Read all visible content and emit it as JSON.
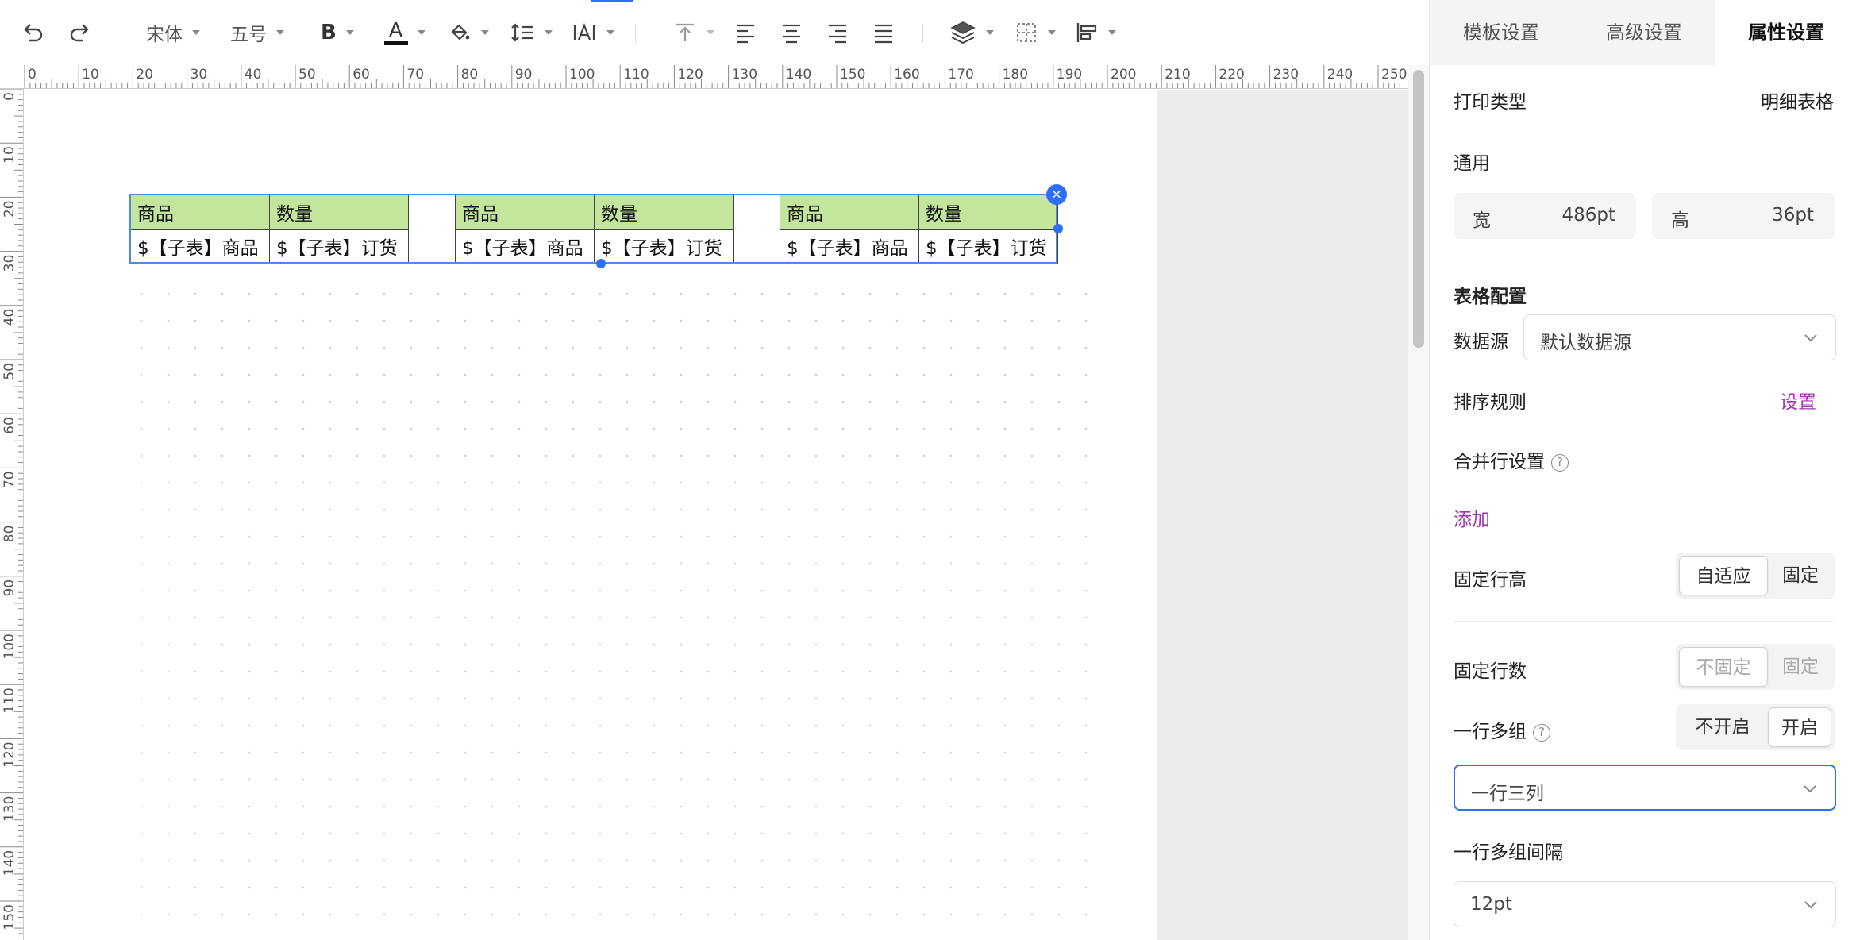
{
  "toolbar": {
    "font_family": "宋体",
    "font_size": "五号",
    "bold_label": "B",
    "font_color_label": "A",
    "font_color": "#111111"
  },
  "ruler": {
    "top_labels": [
      "0",
      "10",
      "20",
      "30",
      "40",
      "50",
      "60",
      "70",
      "80",
      "90",
      "100",
      "110",
      "120",
      "130",
      "140",
      "150",
      "160",
      "170",
      "180",
      "190",
      "200",
      "210",
      "220",
      "230",
      "240",
      "250"
    ],
    "left_labels": [
      "0",
      "10",
      "20",
      "30",
      "40",
      "50",
      "60",
      "70",
      "80",
      "90",
      "100",
      "110",
      "120",
      "130",
      "140",
      "150"
    ]
  },
  "canvas": {
    "tables": [
      {
        "headers": [
          "商品",
          "数量"
        ],
        "cells": [
          "$【子表】商品",
          "$【子表】订货"
        ]
      },
      {
        "headers": [
          "商品",
          "数量"
        ],
        "cells": [
          "$【子表】商品",
          "$【子表】订货"
        ]
      },
      {
        "headers": [
          "商品",
          "数量"
        ],
        "cells": [
          "$【子表】商品",
          "$【子表】订货"
        ]
      }
    ],
    "close_label": "×",
    "header_color": "#c4e59c",
    "selection_color": "#2f6ff5"
  },
  "panel": {
    "tabs": [
      "模板设置",
      "高级设置",
      "属性设置"
    ],
    "active_tab": "属性设置",
    "print_type_label": "打印类型",
    "print_type_value": "明细表格",
    "general_label": "通用",
    "width_label": "宽",
    "width_value": "486pt",
    "height_label": "高",
    "height_value": "36pt",
    "table_config_label": "表格配置",
    "datasource_label": "数据源",
    "datasource_value": "默认数据源",
    "sort_label": "排序规则",
    "sort_link": "设置",
    "merge_label": "合并行设置",
    "help_glyph": "?",
    "add_link": "添加",
    "fixed_height_label": "固定行高",
    "fixed_height_options": [
      "自适应",
      "固定"
    ],
    "fixed_height_selected": "自适应",
    "fixed_rows_label": "固定行数",
    "fixed_rows_options": [
      "不固定",
      "固定"
    ],
    "fixed_rows_selected": "不固定",
    "multi_group_label": "一行多组",
    "multi_group_options": [
      "不开启",
      "开启"
    ],
    "multi_group_selected": "开启",
    "columns_value": "一行三列",
    "group_gap_label": "一行多组间隔",
    "group_gap_value": "12pt",
    "link_color": "#9b3aa8",
    "accent_color": "#2f6ff5"
  }
}
